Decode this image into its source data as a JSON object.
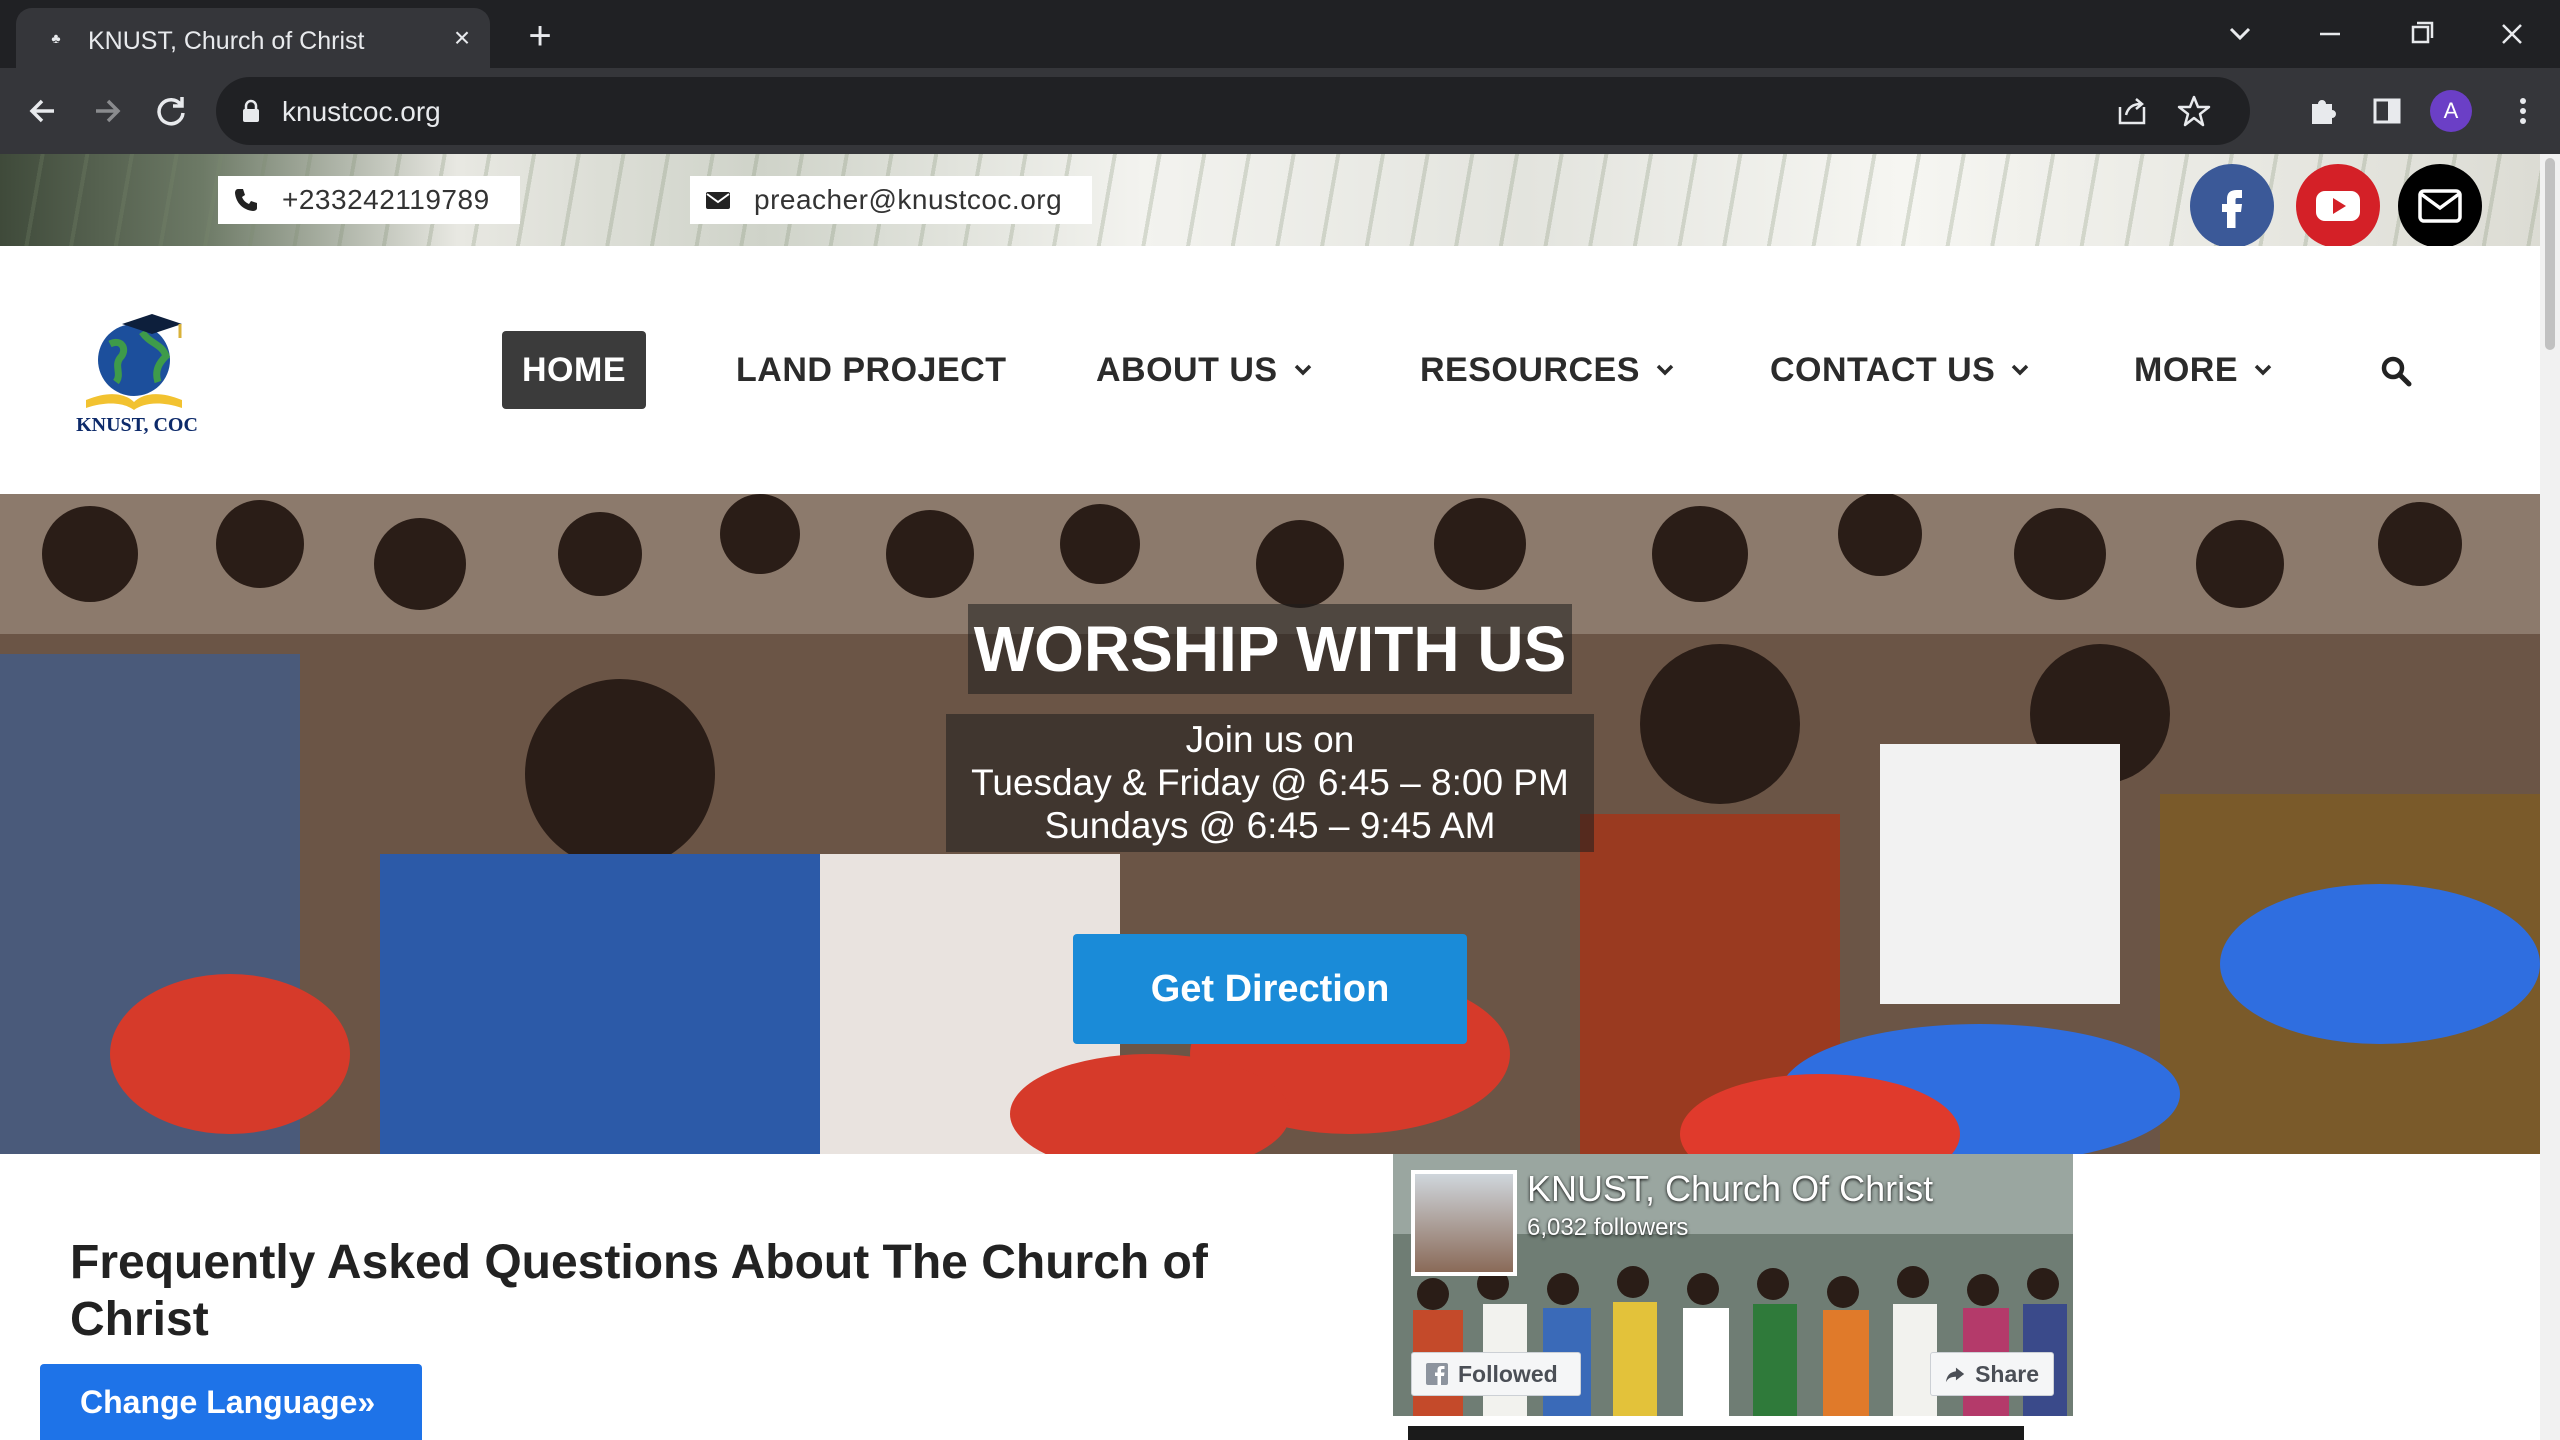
{
  "browser": {
    "tab_title": "KNUST, Church of Christ",
    "url": "knustcoc.org",
    "profile_initial": "A"
  },
  "topbar": {
    "phone": "+233242119789",
    "email": "preacher@knustcoc.org",
    "social": [
      "facebook-icon",
      "youtube-icon",
      "mail-icon"
    ]
  },
  "header": {
    "logo_text": "KNUST, COC",
    "nav": {
      "home": "HOME",
      "land_project": "LAND PROJECT",
      "about_us": "ABOUT US",
      "resources": "RESOURCES",
      "contact_us": "CONTACT US",
      "more": "MORE"
    }
  },
  "hero": {
    "title": "WORSHIP WITH US",
    "line1": "Join us on",
    "line2": "Tuesday & Friday @ 6:45 – 8:00 PM",
    "line3": "Sundays @ 6:45 – 9:45 AM",
    "cta": "Get Direction"
  },
  "faq": {
    "title": "Frequently Asked Questions  About The Church  of Christ"
  },
  "facebook_card": {
    "name": "KNUST, Church Of Christ",
    "followers": "6,032 followers",
    "followed_label": "Followed",
    "share_label": "Share"
  },
  "language_button": "Change Language»",
  "colors": {
    "cta_blue": "#1a8bd8",
    "facebook": "#3b5998",
    "youtube": "#d42027",
    "nav_active": "#3b3b3b",
    "language_button": "#1e73e8"
  }
}
